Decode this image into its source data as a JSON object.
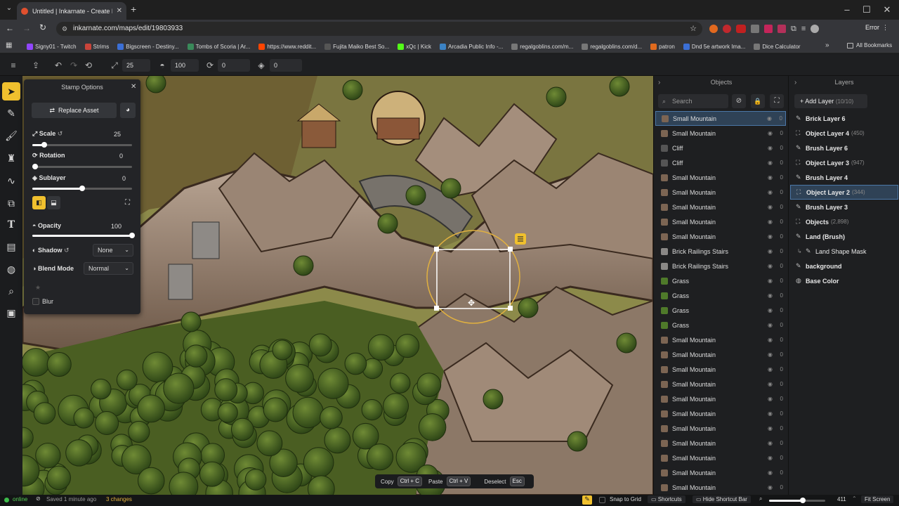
{
  "browser": {
    "tab_title": "Untitled | Inkarnate - Create Fa",
    "url": "inkarnate.com/maps/edit/19803933",
    "profile": "Error",
    "bookmarks": [
      "Signy01 - Twitch",
      "Strims",
      "Bigscreen - Destiny...",
      "Tombs of Scoria | Ar...",
      "https://www.reddit...",
      "Fujita Maiko Best So...",
      "xQc | Kick",
      "Arcadia Public Info -...",
      "regalgoblins.com/m...",
      "regalgoblins.com/d...",
      "patron",
      "Dnd 5e artwork Ima...",
      "Dice Calculator"
    ],
    "all_bookmarks": "All Bookmarks"
  },
  "toolbar": {
    "scale": "25",
    "opacity": "100",
    "rotation": "0",
    "sublayer": "0"
  },
  "stamp_options": {
    "title": "Stamp Options",
    "replace_asset": "Replace Asset",
    "scale_label": "Scale",
    "scale_value": "25",
    "rotation_label": "Rotation",
    "rotation_value": "0",
    "sublayer_label": "Sublayer",
    "sublayer_value": "0",
    "opacity_label": "Opacity",
    "opacity_value": "100",
    "shadow_label": "Shadow",
    "shadow_value": "None",
    "blend_label": "Blend Mode",
    "blend_value": "Normal",
    "blur_label": "Blur",
    "scale_level": 0.12,
    "rotation_level": 0.0,
    "sublayer_level": 0.5,
    "opacity_level": 1.0
  },
  "objects": {
    "title": "Objects",
    "search_placeholder": "Search",
    "items": [
      {
        "name": "Small Mountain",
        "count": "0",
        "selected": true
      },
      {
        "name": "Small Mountain",
        "count": "0"
      },
      {
        "name": "Cliff",
        "count": "0"
      },
      {
        "name": "Cliff",
        "count": "0"
      },
      {
        "name": "Small Mountain",
        "count": "0"
      },
      {
        "name": "Small Mountain",
        "count": "0"
      },
      {
        "name": "Small Mountain",
        "count": "0"
      },
      {
        "name": "Small Mountain",
        "count": "0"
      },
      {
        "name": "Small Mountain",
        "count": "0"
      },
      {
        "name": "Brick Railings Stairs",
        "count": "0"
      },
      {
        "name": "Brick Railings Stairs",
        "count": "0"
      },
      {
        "name": "Grass",
        "count": "0"
      },
      {
        "name": "Grass",
        "count": "0"
      },
      {
        "name": "Grass",
        "count": "0"
      },
      {
        "name": "Grass",
        "count": "0"
      },
      {
        "name": "Small Mountain",
        "count": "0"
      },
      {
        "name": "Small Mountain",
        "count": "0"
      },
      {
        "name": "Small Mountain",
        "count": "0"
      },
      {
        "name": "Small Mountain",
        "count": "0"
      },
      {
        "name": "Small Mountain",
        "count": "0"
      },
      {
        "name": "Small Mountain",
        "count": "0"
      },
      {
        "name": "Small Mountain",
        "count": "0"
      },
      {
        "name": "Small Mountain",
        "count": "0"
      },
      {
        "name": "Small Mountain",
        "count": "0"
      },
      {
        "name": "Small Mountain",
        "count": "0"
      },
      {
        "name": "Small Mountain",
        "count": "0"
      }
    ]
  },
  "layers": {
    "title": "Layers",
    "add_label": "Add Layer",
    "add_count": "(10/10)",
    "items": [
      {
        "name": "Brick Layer 6",
        "sub": ""
      },
      {
        "name": "Object Layer 4",
        "sub": "(450)"
      },
      {
        "name": "Brush Layer 6",
        "sub": ""
      },
      {
        "name": "Object Layer 3",
        "sub": "(947)"
      },
      {
        "name": "Brush Layer 4",
        "sub": ""
      },
      {
        "name": "Object Layer 2",
        "sub": "(344)",
        "selected": true
      },
      {
        "name": "Brush Layer 3",
        "sub": ""
      },
      {
        "name": "Objects",
        "sub": "(2,898)"
      },
      {
        "name": "Land (Brush)",
        "sub": ""
      },
      {
        "name": "Land Shape Mask",
        "sub": "",
        "indent": true
      },
      {
        "name": "background",
        "sub": ""
      },
      {
        "name": "Base Color",
        "sub": ""
      }
    ]
  },
  "shortcut_bar": {
    "copy": "Copy",
    "copy_key": "Ctrl + C",
    "paste": "Paste",
    "paste_key": "Ctrl + V",
    "deselect": "Deselect",
    "deselect_key": "Esc"
  },
  "status": {
    "online": "online",
    "saved": "Saved 1 minute ago",
    "changes": "3 changes",
    "snap": "Snap to Grid",
    "shortcuts": "Shortcuts",
    "hide_shortcut": "Hide Shortcut Bar",
    "zoom": "411",
    "fit": "Fit Screen",
    "zoom_level": 0.6
  }
}
